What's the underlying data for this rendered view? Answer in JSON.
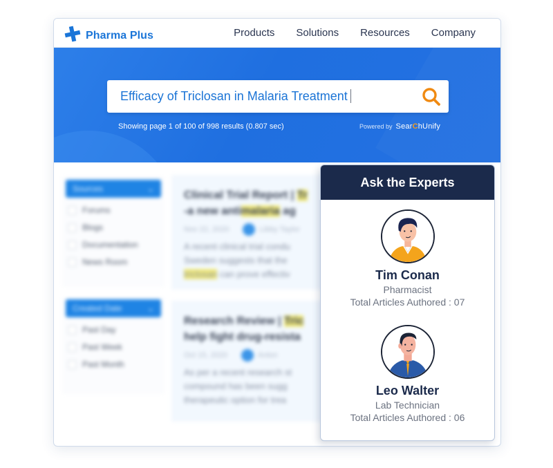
{
  "brand": {
    "name": "Pharma Plus",
    "logo_icon": "cross-plus-icon",
    "color": "#1a75d8"
  },
  "nav": {
    "items": [
      {
        "label": "Products"
      },
      {
        "label": "Solutions"
      },
      {
        "label": "Resources"
      },
      {
        "label": "Company"
      }
    ]
  },
  "search": {
    "query": "Efficacy of Triclosan in Malaria Treatment",
    "icon": "search-icon",
    "icon_color": "#f08a12",
    "results_summary": "Showing page 1 of 100 of 998 results (0.807 sec)",
    "powered_by_label": "Powered by",
    "powered_by_brand_pre": "Sear",
    "powered_by_brand_c": "C",
    "powered_by_brand_post": "hUnify"
  },
  "facets": [
    {
      "title": "Sources",
      "options": [
        "Forums",
        "Blogs",
        "Documentation",
        "News Room"
      ]
    },
    {
      "title": "Created Date",
      "options": [
        "Past Day",
        "Past Week",
        "Past Month"
      ]
    }
  ],
  "results": [
    {
      "title_pre": "Clinical Trial Report | ",
      "title_hl": "Tr",
      "title_line2_pre": "-a new anti",
      "title_line2_hl": "malaria",
      "title_line2_post": " ag",
      "date": "Nov 22, 2020",
      "author": "Libby Taylor",
      "body_1": "A recent clinical trial condu",
      "body_2": "Sweden suggests that the",
      "body_3_hl": "triclosan",
      "body_3_post": " can prove effectiv"
    },
    {
      "title_pre": "Research Review | ",
      "title_hl": "Tric",
      "title_line2_pre": "help fight drug-resista",
      "title_line2_hl": "",
      "title_line2_post": "",
      "date": "Oct 15, 2020",
      "author": "Anton",
      "body_1": "As per a recent research st",
      "body_2": "compound has been sugg",
      "body_3_hl": "",
      "body_3_post": "therapeutic option for trea"
    }
  ],
  "experts": {
    "title": "Ask the Experts",
    "header_color": "#1b2a4b",
    "items": [
      {
        "name": "Tim Conan",
        "role": "Pharmacist",
        "articles": "Total Articles Authored : 07",
        "avatar": "man-yellow-jacket-avatar"
      },
      {
        "name": "Leo Walter",
        "role": "Lab Technician",
        "articles": "Total Articles Authored : 06",
        "avatar": "man-blue-shirt-tie-avatar"
      }
    ]
  }
}
